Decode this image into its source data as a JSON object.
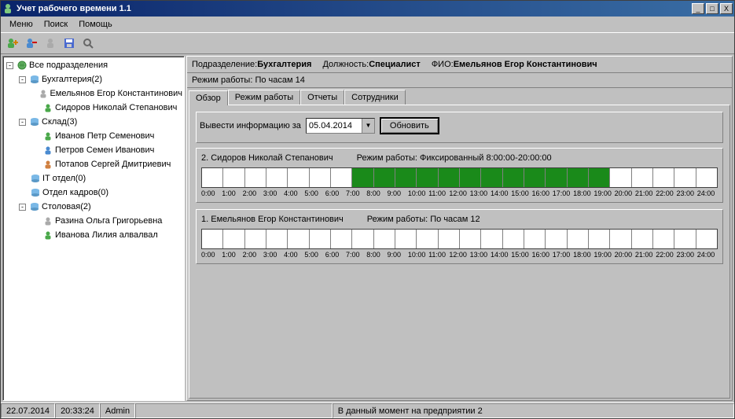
{
  "title": "Учет рабочего времени 1.1",
  "menu": {
    "items": [
      "Меню",
      "Поиск",
      "Помощь"
    ]
  },
  "tree": {
    "root": "Все подразделения",
    "nodes": [
      {
        "label": "Бухгалтерия(2)",
        "children": [
          "Емельянов Егор Константинович",
          "Сидоров Николай Степанович"
        ]
      },
      {
        "label": "Склад(3)",
        "children": [
          "Иванов Петр Семенович",
          "Петров Семен Иванович",
          "Потапов Сергей Дмитриевич"
        ]
      },
      {
        "label": "IT отдел(0)",
        "children": []
      },
      {
        "label": "Отдел кадров(0)",
        "children": []
      },
      {
        "label": "Столовая(2)",
        "children": [
          "Разина Ольга Григорьевна",
          "Иванова Лилия алвалвал"
        ]
      }
    ]
  },
  "info": {
    "dept_label": "Подразделение:",
    "dept": "Бухгалтерия",
    "pos_label": "Должность:",
    "pos": "Специалист",
    "name_label": "ФИО:",
    "name": "Емельянов Егор Константинович"
  },
  "mode": {
    "label": "Режим работы:",
    "value": "По часам   14"
  },
  "tabs": [
    "Обзор",
    "Режим работы",
    "Отчеты",
    "Сотрудники"
  ],
  "filter": {
    "label": "Вывести информацию за",
    "date": "05.04.2014",
    "btn": "Обновить"
  },
  "employees": [
    {
      "title": "2. Сидоров Николай Степанович",
      "mode_label": "Режим работы:",
      "mode": "Фиксированный   8:00:00-20:00:00",
      "fill_start": 7,
      "fill_end": 19
    },
    {
      "title": "1. Емельянов Егор Константинович",
      "mode_label": "Режим работы:",
      "mode": "По часам   12",
      "fill_start": -1,
      "fill_end": -1
    }
  ],
  "hours": [
    "0:00",
    "1:00",
    "2:00",
    "3:00",
    "4:00",
    "5:00",
    "6:00",
    "7:00",
    "8:00",
    "9:00",
    "10:00",
    "11:00",
    "12:00",
    "13:00",
    "14:00",
    "15:00",
    "16:00",
    "17:00",
    "18:00",
    "19:00",
    "20:00",
    "21:00",
    "22:00",
    "23:00",
    "24:00"
  ],
  "status": {
    "date": "22.07.2014",
    "time": "20:33:24",
    "user": "Admin",
    "msg": "В данный момент на предприятии 2"
  }
}
